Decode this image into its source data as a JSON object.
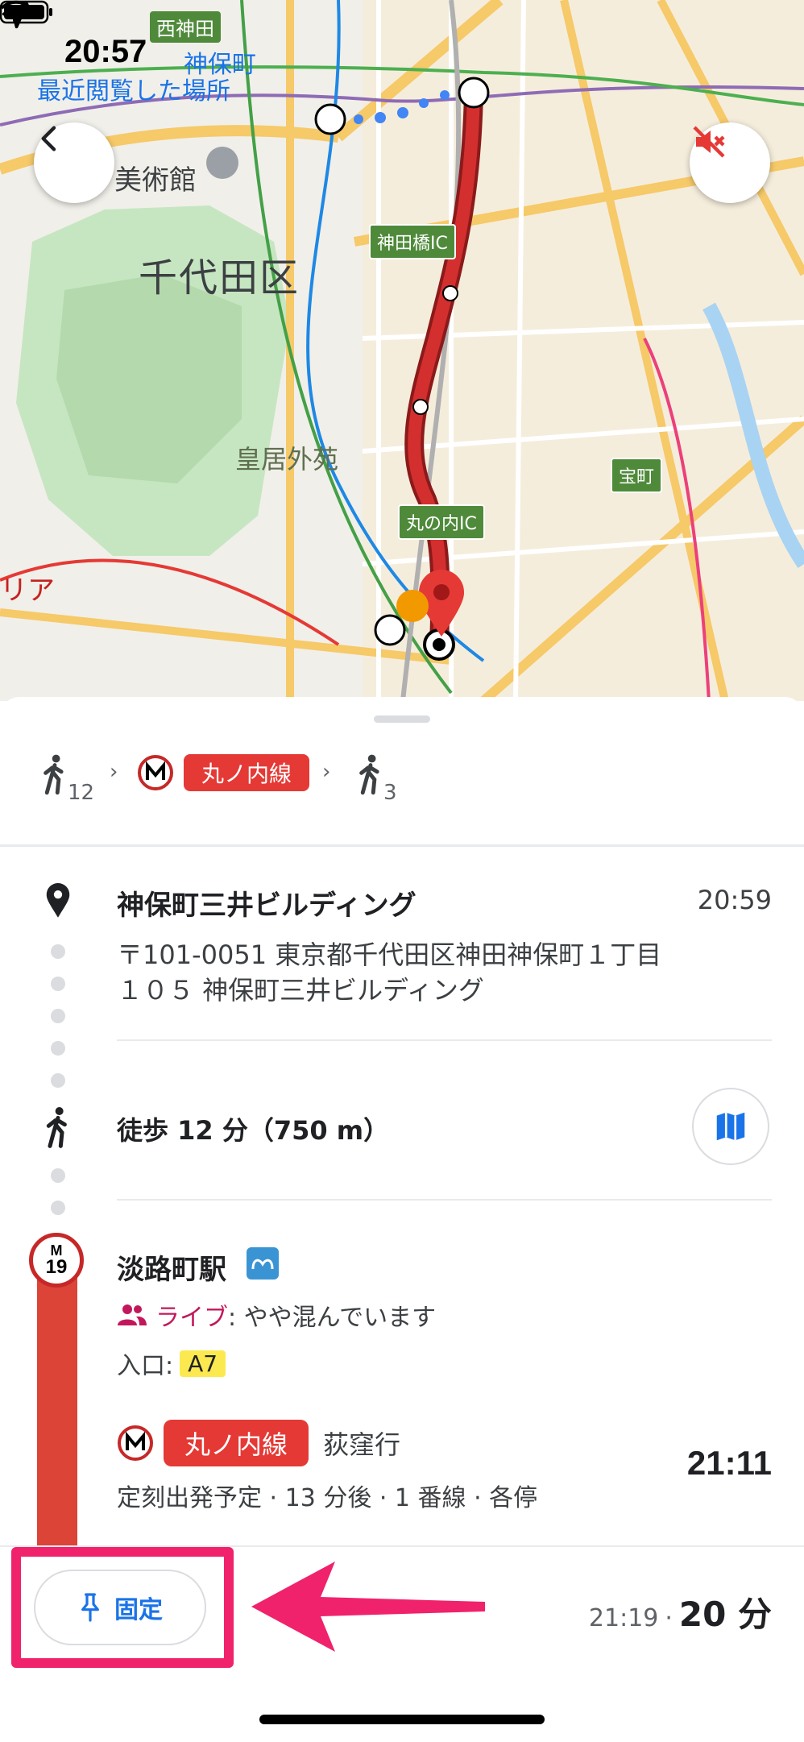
{
  "status_bar": {
    "time": "20:57"
  },
  "map": {
    "labels": {
      "nishikanda": "西神田",
      "jinbocho": "神保町",
      "recent": "最近閲覧した場所",
      "museum": "美術館",
      "ward": "千代田区",
      "kokyo": "皇居外苑",
      "kanda_ic": "神田橋IC",
      "marunouchi_ic": "丸の内IC",
      "takaracho": "宝町",
      "area_cut": "リア"
    },
    "colors": {
      "route": "#d32f2f",
      "park": "#c6e6c1",
      "road": "#f6c969"
    }
  },
  "summary": {
    "walk1_minutes": "12",
    "line_name": "丸ノ内線",
    "walk2_minutes": "3"
  },
  "origin": {
    "name": "神保町三井ビルディング",
    "time": "20:59",
    "address": "〒101-0051 東京都千代田区神田神保町１丁目１０５ 神保町三井ビルディング"
  },
  "walk_step": {
    "text": "徒歩 12 分（750 m）"
  },
  "station": {
    "badge_letter": "M",
    "badge_number": "19",
    "name": "淡路町駅",
    "crowd_label": "ライブ",
    "crowd_text": ": やや混んでいます",
    "entrance_label": "入口:",
    "exit": "A7",
    "line_name": "丸ノ内線",
    "destination": "荻窪行",
    "depart_info": "定刻出発予定 · 13 分後 · 1 番線 · 各停",
    "depart_time": "21:11"
  },
  "footer": {
    "pin_label": "固定",
    "arrival_time": "21:19",
    "separator": "·",
    "duration": "20 分"
  }
}
